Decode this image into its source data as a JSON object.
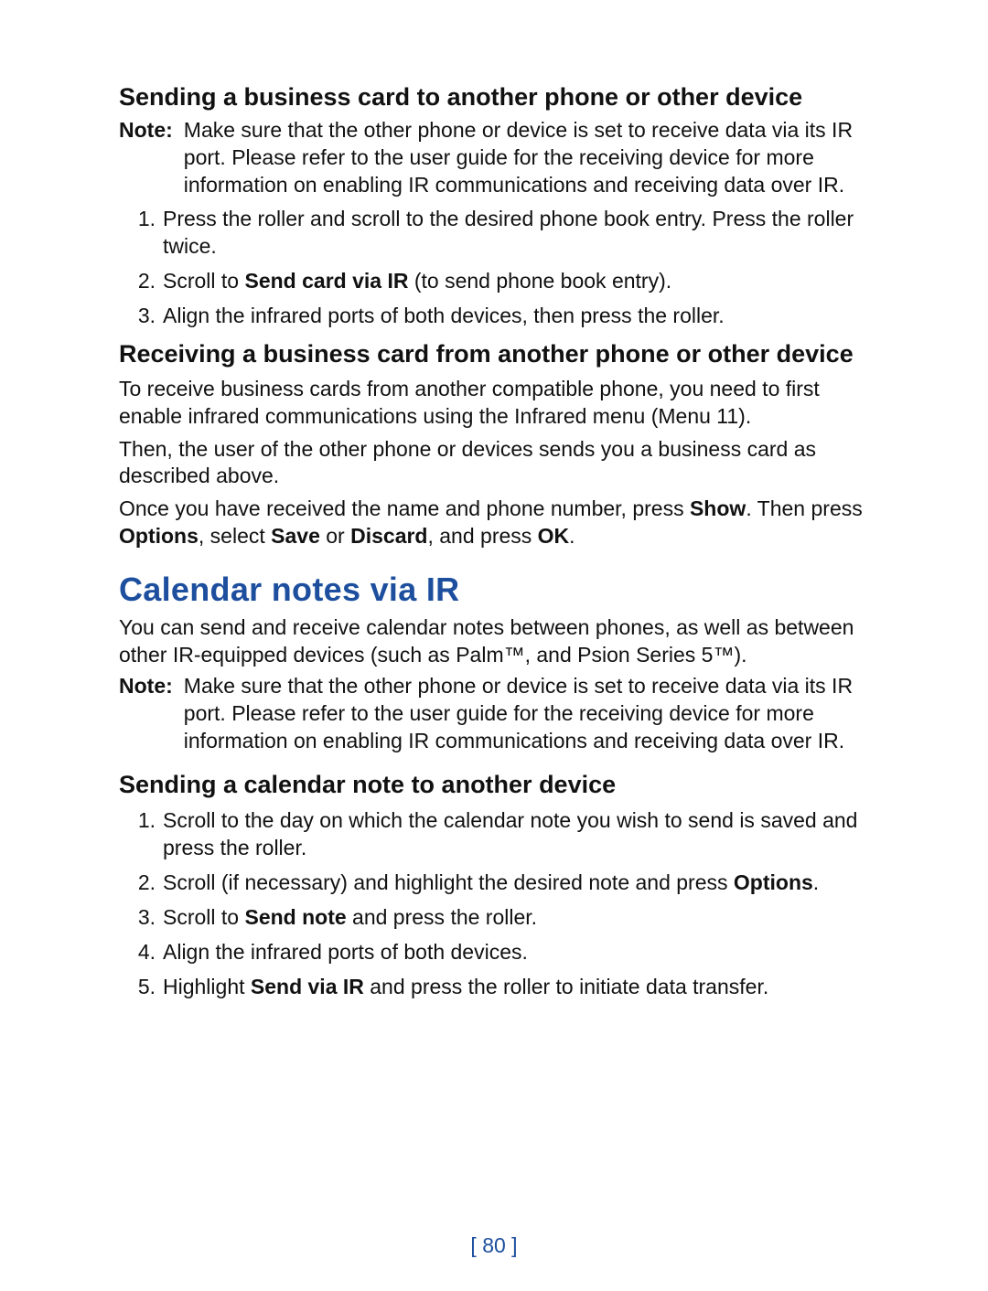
{
  "s1": {
    "heading": "Sending a business card to another phone or other device",
    "note_label": "Note:",
    "note_body": "Make sure that the other phone or device is set to receive data via its IR port. Please refer to the user guide for the receiving device for more information on enabling IR communications and receiving data over IR.",
    "li1": "Press the roller and scroll to the desired phone book entry. Press the roller twice.",
    "li2a": "Scroll to ",
    "li2b": "Send card via IR",
    "li2c": " (to send phone book entry).",
    "li3": "Align the infrared ports of both devices, then press the roller."
  },
  "s2": {
    "heading": "Receiving a business card from another phone or other device",
    "p1": "To receive business cards from another compatible phone, you need to first enable infrared communications using the Infrared menu (Menu 11).",
    "p2": "Then, the user of the other phone or devices sends you a business card as described above.",
    "p3a": "Once you have received the name and phone number, press ",
    "p3b": "Show",
    "p3c": ". Then press ",
    "p3d": "Options",
    "p3e": ", select ",
    "p3f": "Save",
    "p3g": " or ",
    "p3h": "Discard",
    "p3i": ", and press ",
    "p3j": "OK",
    "p3k": "."
  },
  "s3": {
    "heading": "Calendar notes via IR",
    "p1": "You can send and receive calendar notes between phones, as well as between other IR-equipped devices (such as Palm™, and Psion Series 5™).",
    "note_label": "Note:",
    "note_body": "Make sure that the other phone or device is set to receive data via its IR port. Please refer to the user guide for the receiving device for more information on enabling IR communications and receiving data over IR."
  },
  "s4": {
    "heading": "Sending a calendar note to another device",
    "li1": "Scroll to the day on which the calendar note you wish to send is saved and press the roller.",
    "li2a": "Scroll (if necessary) and highlight the desired note and press ",
    "li2b": "Options",
    "li2c": ".",
    "li3a": "Scroll to ",
    "li3b": "Send note",
    "li3c": " and press the roller.",
    "li4": "Align the infrared ports of both devices.",
    "li5a": "Highlight ",
    "li5b": "Send via IR",
    "li5c": " and press the roller to initiate data transfer."
  },
  "nums": {
    "n1": "1.",
    "n2": "2.",
    "n3": "3.",
    "n4": "4.",
    "n5": "5."
  },
  "page_number": "[ 80 ]"
}
